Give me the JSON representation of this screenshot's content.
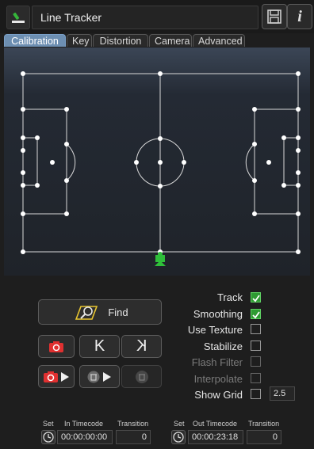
{
  "header": {
    "title": "Line Tracker",
    "save_icon": "save-icon",
    "info_label": "i"
  },
  "tabs": [
    {
      "label": "Calibration",
      "active": true
    },
    {
      "label": "Key",
      "active": false
    },
    {
      "label": "Distortion",
      "active": false
    },
    {
      "label": "Camera",
      "active": false
    },
    {
      "label": "Advanced",
      "active": false
    }
  ],
  "buttons": {
    "find_label": "Find",
    "prev_key": "K",
    "next_key": "K"
  },
  "options": [
    {
      "label": "Track",
      "checked": true,
      "enabled": true
    },
    {
      "label": "Smoothing",
      "checked": true,
      "enabled": true
    },
    {
      "label": "Use Texture",
      "checked": false,
      "enabled": true
    },
    {
      "label": "Stabilize",
      "checked": false,
      "enabled": true
    },
    {
      "label": "Flash Filter",
      "checked": false,
      "enabled": false
    },
    {
      "label": "Interpolate",
      "checked": false,
      "enabled": false
    },
    {
      "label": "Show Grid",
      "checked": false,
      "enabled": true
    }
  ],
  "grid_value": "2.5",
  "timecode": {
    "set_label": "Set",
    "in_label": "In Timecode",
    "out_label": "Out Timecode",
    "transition_label": "Transition",
    "in_value": "00:00:00:00",
    "in_transition": "0",
    "out_value": "00:00:23:18",
    "out_transition": "0"
  },
  "colors": {
    "accent": "#6d8fb2",
    "check": "#2e9a32",
    "record": "#e03030",
    "camera_marker": "#2fbf3a"
  }
}
